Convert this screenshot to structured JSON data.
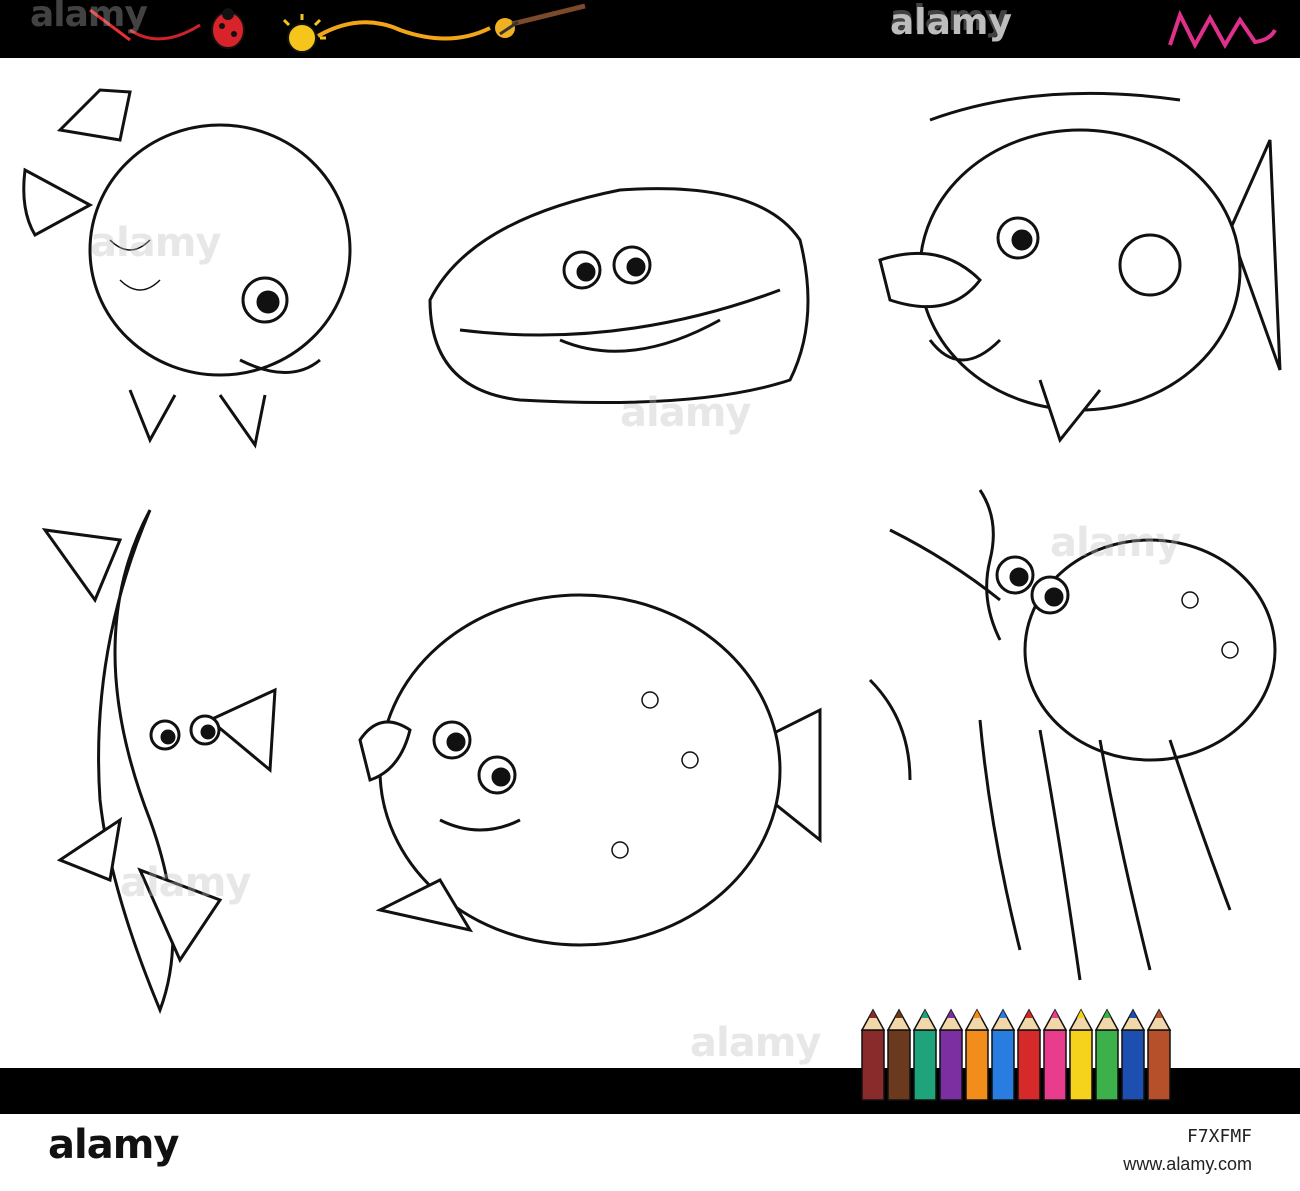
{
  "watermark": "alamy",
  "footer": {
    "brand": "alamy",
    "image_id": "F7XFMF",
    "url": "www.alamy.com"
  },
  "colors": {
    "bar": "#000000",
    "pink_logo": "#e0308c",
    "pencils": [
      "#8a2b2b",
      "#6b3a1e",
      "#1fa37a",
      "#7b2fa0",
      "#f28c1b",
      "#2a7de0",
      "#d62a2a",
      "#e83c8c",
      "#f5d21c",
      "#3cb04a",
      "#1c4fb0",
      "#b5502a"
    ]
  },
  "icons": [
    "ladybug-icon",
    "sun-icon",
    "paintbrush-icon",
    "pencil-icon",
    "colored-pencils-icon"
  ],
  "characters": [
    "fish-top-left",
    "whale-top-center",
    "fish-top-right",
    "fish-bottom-left",
    "flatfish-bottom-center",
    "octopus-bottom-right"
  ]
}
